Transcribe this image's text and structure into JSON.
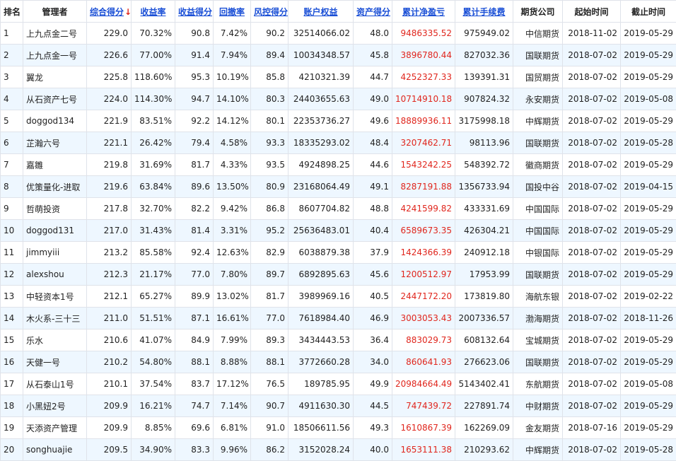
{
  "headers": {
    "rank": "排名",
    "manager": "管理者",
    "score": "综合得分",
    "sort_arrow": "↓",
    "return_rate": "收益率",
    "return_score": "收益得分",
    "drawdown": "回撤率",
    "risk_score": "风控得分",
    "equity": "账户权益",
    "asset_score": "资产得分",
    "net_profit": "累计净盈亏",
    "fees": "累计手续费",
    "broker": "期货公司",
    "start": "起始时间",
    "end": "截止时间"
  },
  "rows": [
    {
      "rank": "1",
      "manager": "上九点金二号",
      "score": "229.0",
      "return_rate": "70.32%",
      "return_score": "90.8",
      "drawdown": "7.42%",
      "risk_score": "90.2",
      "equity": "32514066.02",
      "asset_score": "48.0",
      "net_profit": "9486335.52",
      "fees": "975949.02",
      "broker": "中信期货",
      "start": "2018-11-02",
      "end": "2019-05-29"
    },
    {
      "rank": "2",
      "manager": "上九点金一号",
      "score": "226.6",
      "return_rate": "77.00%",
      "return_score": "91.4",
      "drawdown": "7.94%",
      "risk_score": "89.4",
      "equity": "10034348.57",
      "asset_score": "45.8",
      "net_profit": "3896780.44",
      "fees": "827032.36",
      "broker": "国联期货",
      "start": "2018-07-02",
      "end": "2019-05-29"
    },
    {
      "rank": "3",
      "manager": "翼龙",
      "score": "225.8",
      "return_rate": "118.60%",
      "return_score": "95.3",
      "drawdown": "10.19%",
      "risk_score": "85.8",
      "equity": "4210321.39",
      "asset_score": "44.7",
      "net_profit": "4252327.33",
      "fees": "139391.31",
      "broker": "国贸期货",
      "start": "2018-07-02",
      "end": "2019-05-29"
    },
    {
      "rank": "4",
      "manager": "从石资产七号",
      "score": "224.0",
      "return_rate": "114.30%",
      "return_score": "94.7",
      "drawdown": "14.10%",
      "risk_score": "80.3",
      "equity": "24403655.63",
      "asset_score": "49.0",
      "net_profit": "10714910.18",
      "fees": "907824.32",
      "broker": "永安期货",
      "start": "2018-07-02",
      "end": "2019-05-08"
    },
    {
      "rank": "5",
      "manager": "doggod134",
      "score": "221.9",
      "return_rate": "83.51%",
      "return_score": "92.2",
      "drawdown": "14.12%",
      "risk_score": "80.1",
      "equity": "22353736.27",
      "asset_score": "49.6",
      "net_profit": "18889936.11",
      "fees": "3175998.18",
      "broker": "中辉期货",
      "start": "2018-07-02",
      "end": "2019-05-29"
    },
    {
      "rank": "6",
      "manager": "芷瀚六号",
      "score": "221.1",
      "return_rate": "26.42%",
      "return_score": "79.4",
      "drawdown": "4.58%",
      "risk_score": "93.3",
      "equity": "18335293.02",
      "asset_score": "48.4",
      "net_profit": "3207462.71",
      "fees": "98113.96",
      "broker": "国联期货",
      "start": "2018-07-02",
      "end": "2019-05-28"
    },
    {
      "rank": "7",
      "manager": "嘉雛",
      "score": "219.8",
      "return_rate": "31.69%",
      "return_score": "81.7",
      "drawdown": "4.33%",
      "risk_score": "93.5",
      "equity": "4924898.25",
      "asset_score": "44.6",
      "net_profit": "1543242.25",
      "fees": "548392.72",
      "broker": "徽商期货",
      "start": "2018-07-02",
      "end": "2019-05-29"
    },
    {
      "rank": "8",
      "manager": "优策量化-进取",
      "score": "219.6",
      "return_rate": "63.84%",
      "return_score": "89.6",
      "drawdown": "13.50%",
      "risk_score": "80.9",
      "equity": "23168064.49",
      "asset_score": "49.1",
      "net_profit": "8287191.88",
      "fees": "1356733.94",
      "broker": "国投中谷",
      "start": "2018-07-02",
      "end": "2019-04-15"
    },
    {
      "rank": "9",
      "manager": "哲萌投资",
      "score": "217.8",
      "return_rate": "32.70%",
      "return_score": "82.2",
      "drawdown": "9.42%",
      "risk_score": "86.8",
      "equity": "8607704.82",
      "asset_score": "48.8",
      "net_profit": "4241599.82",
      "fees": "433331.69",
      "broker": "中国国际",
      "start": "2018-07-02",
      "end": "2019-05-29"
    },
    {
      "rank": "10",
      "manager": "doggod131",
      "score": "217.0",
      "return_rate": "31.43%",
      "return_score": "81.4",
      "drawdown": "3.31%",
      "risk_score": "95.2",
      "equity": "25636483.01",
      "asset_score": "40.4",
      "net_profit": "6589673.35",
      "fees": "426304.21",
      "broker": "中国国际",
      "start": "2018-07-02",
      "end": "2019-05-29"
    },
    {
      "rank": "11",
      "manager": "jimmyiii",
      "score": "213.2",
      "return_rate": "85.58%",
      "return_score": "92.4",
      "drawdown": "12.63%",
      "risk_score": "82.9",
      "equity": "6038879.38",
      "asset_score": "37.9",
      "net_profit": "1424366.39",
      "fees": "240912.18",
      "broker": "中银国际",
      "start": "2018-07-02",
      "end": "2019-05-29"
    },
    {
      "rank": "12",
      "manager": "alexshou",
      "score": "212.3",
      "return_rate": "21.17%",
      "return_score": "77.0",
      "drawdown": "7.80%",
      "risk_score": "89.7",
      "equity": "6892895.63",
      "asset_score": "45.6",
      "net_profit": "1200512.97",
      "fees": "17953.99",
      "broker": "国联期货",
      "start": "2018-07-02",
      "end": "2019-05-29"
    },
    {
      "rank": "13",
      "manager": "中轻资本1号",
      "score": "212.1",
      "return_rate": "65.27%",
      "return_score": "89.9",
      "drawdown": "13.02%",
      "risk_score": "81.7",
      "equity": "3989969.16",
      "asset_score": "40.5",
      "net_profit": "2447172.20",
      "fees": "173819.80",
      "broker": "海航东银",
      "start": "2018-07-02",
      "end": "2019-02-22"
    },
    {
      "rank": "14",
      "manager": "木火系-三十三",
      "score": "211.0",
      "return_rate": "51.51%",
      "return_score": "87.1",
      "drawdown": "16.61%",
      "risk_score": "77.0",
      "equity": "7618984.40",
      "asset_score": "46.9",
      "net_profit": "3003053.43",
      "fees": "2007336.57",
      "broker": "渤海期货",
      "start": "2018-07-02",
      "end": "2018-11-26"
    },
    {
      "rank": "15",
      "manager": "乐水",
      "score": "210.6",
      "return_rate": "41.07%",
      "return_score": "84.9",
      "drawdown": "7.99%",
      "risk_score": "89.3",
      "equity": "3434443.53",
      "asset_score": "36.4",
      "net_profit": "883029.73",
      "fees": "608132.64",
      "broker": "宝城期货",
      "start": "2018-07-02",
      "end": "2019-05-29"
    },
    {
      "rank": "16",
      "manager": "天健一号",
      "score": "210.2",
      "return_rate": "54.80%",
      "return_score": "88.1",
      "drawdown": "8.88%",
      "risk_score": "88.1",
      "equity": "3772660.28",
      "asset_score": "34.0",
      "net_profit": "860641.93",
      "fees": "276623.06",
      "broker": "国联期货",
      "start": "2018-07-02",
      "end": "2019-05-29"
    },
    {
      "rank": "17",
      "manager": "从石泰山1号",
      "score": "210.1",
      "return_rate": "37.54%",
      "return_score": "83.7",
      "drawdown": "17.12%",
      "risk_score": "76.5",
      "equity": "189785.95",
      "asset_score": "49.9",
      "net_profit": "20984664.49",
      "fees": "5143402.41",
      "broker": "东航期货",
      "start": "2018-07-02",
      "end": "2019-05-08"
    },
    {
      "rank": "18",
      "manager": "小黑妞2号",
      "score": "209.9",
      "return_rate": "16.21%",
      "return_score": "74.7",
      "drawdown": "7.14%",
      "risk_score": "90.7",
      "equity": "4911630.30",
      "asset_score": "44.5",
      "net_profit": "747439.72",
      "fees": "227891.74",
      "broker": "中财期货",
      "start": "2018-07-02",
      "end": "2019-05-29"
    },
    {
      "rank": "19",
      "manager": "天添资产管理",
      "score": "209.9",
      "return_rate": "8.85%",
      "return_score": "69.6",
      "drawdown": "6.81%",
      "risk_score": "91.0",
      "equity": "18506611.56",
      "asset_score": "49.3",
      "net_profit": "1610867.39",
      "fees": "162269.09",
      "broker": "金友期货",
      "start": "2018-07-16",
      "end": "2019-05-29"
    },
    {
      "rank": "20",
      "manager": "songhuajie",
      "score": "209.5",
      "return_rate": "34.90%",
      "return_score": "83.3",
      "drawdown": "9.96%",
      "risk_score": "86.2",
      "equity": "3152028.24",
      "asset_score": "40.0",
      "net_profit": "1653111.38",
      "fees": "210293.62",
      "broker": "中辉期货",
      "start": "2018-07-02",
      "end": "2019-05-28"
    }
  ],
  "colors": {
    "link": "#1a4fd6",
    "profit": "#e0261d",
    "stripe": "#eef7ff",
    "border": "#dfe3ea"
  }
}
